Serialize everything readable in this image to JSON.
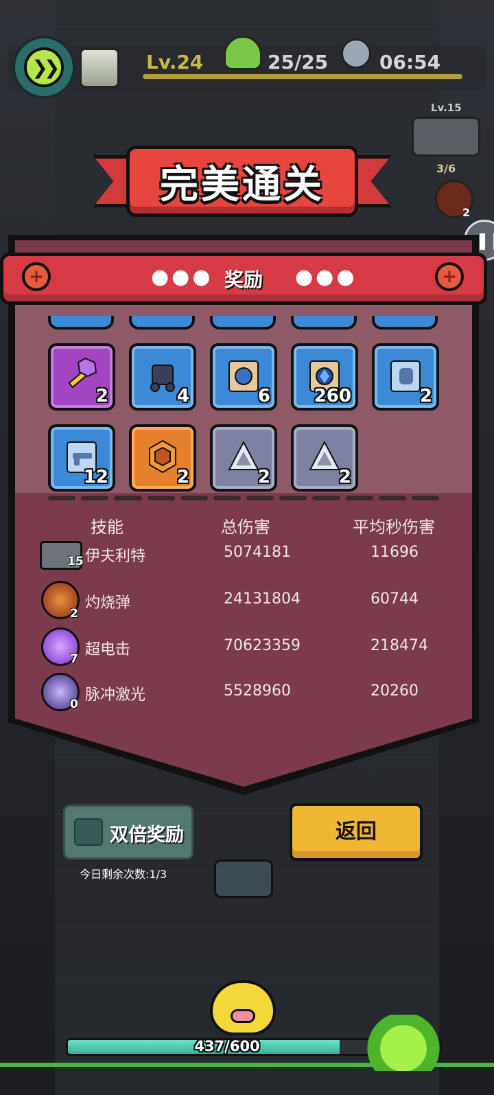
{
  "hud": {
    "level": "Lv.24",
    "wave": "25/25",
    "time": "06:54",
    "fast_forward_icon": "double-chevron-right-icon"
  },
  "side": {
    "weapon_level": "Lv.15",
    "slots": "3/6",
    "skill_count": "2"
  },
  "banner": {
    "title": "完美通关"
  },
  "rewards": {
    "header": "奖励",
    "dots": "●●●",
    "items": [
      {
        "icon": "key-icon",
        "qty": "2",
        "quality": "purple"
      },
      {
        "icon": "ore-icon",
        "qty": "4",
        "quality": "blue"
      },
      {
        "icon": "coin-scroll-icon",
        "qty": "6",
        "quality": "blue"
      },
      {
        "icon": "gem-scroll-icon",
        "qty": "260",
        "quality": "blue"
      },
      {
        "icon": "glove-scroll-icon",
        "qty": "2",
        "quality": "blue"
      },
      {
        "icon": "pistol-scroll-icon",
        "qty": "12",
        "quality": "blue"
      },
      {
        "icon": "hex-core-icon",
        "qty": "2",
        "quality": "orange"
      },
      {
        "icon": "triangle-crystal-icon",
        "qty": "2",
        "quality": "gray"
      },
      {
        "icon": "triangle-crystal-icon",
        "qty": "2",
        "quality": "gray"
      }
    ]
  },
  "stats": {
    "headers": [
      "技能",
      "总伤害",
      "平均秒伤害"
    ],
    "rows": [
      {
        "name": "伊夫利特",
        "level": "15",
        "total": "5074181",
        "dps": "11696",
        "icon": "gun-weapon-icon"
      },
      {
        "name": "灼烧弹",
        "level": "2",
        "total": "24131804",
        "dps": "60744",
        "icon": "fire-bullet-icon"
      },
      {
        "name": "超电击",
        "level": "7",
        "total": "70623359",
        "dps": "218474",
        "icon": "lightning-icon"
      },
      {
        "name": "脉冲激光",
        "level": "0",
        "total": "5528960",
        "dps": "20260",
        "icon": "laser-icon"
      }
    ]
  },
  "buttons": {
    "double_reward": "双倍奖励",
    "remaining": "今日剩余次数:1/3",
    "back": "返回"
  },
  "exp": {
    "text": "437/600",
    "progress": 0.73
  },
  "colors": {
    "banner_red": "#e8453f",
    "panel": "#7c3b4c",
    "back_button": "#f0b733",
    "exp_fill": "#36b39a"
  }
}
